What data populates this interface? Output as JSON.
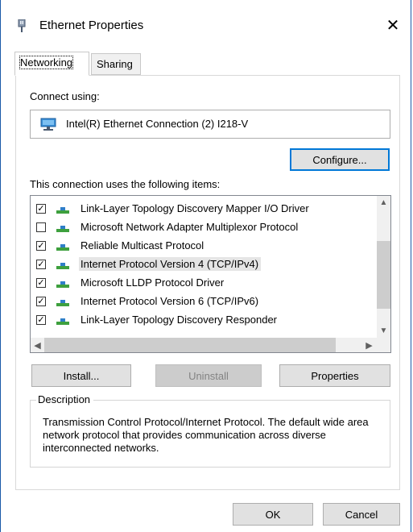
{
  "window": {
    "title": "Ethernet Properties",
    "close_glyph": "✕"
  },
  "tabs": [
    {
      "label": "Networking"
    },
    {
      "label": "Sharing"
    }
  ],
  "networking": {
    "connect_using_label": "Connect using:",
    "adapter_name": "Intel(R) Ethernet Connection (2) I218-V",
    "configure_label": "Configure...",
    "items_label": "This connection uses the following items:",
    "items": [
      {
        "label": "Link-Layer Topology Discovery Mapper I/O Driver",
        "checked": true,
        "icon": "network-protocol-icon"
      },
      {
        "label": "Microsoft Network Adapter Multiplexor Protocol",
        "checked": false,
        "icon": "network-protocol-icon"
      },
      {
        "label": "Reliable Multicast Protocol",
        "checked": true,
        "icon": "network-protocol-icon"
      },
      {
        "label": "Internet Protocol Version 4 (TCP/IPv4)",
        "checked": true,
        "icon": "network-protocol-icon",
        "selected": true
      },
      {
        "label": "Microsoft LLDP Protocol Driver",
        "checked": true,
        "icon": "network-protocol-icon"
      },
      {
        "label": "Internet Protocol Version 6 (TCP/IPv6)",
        "checked": true,
        "icon": "network-protocol-icon"
      },
      {
        "label": "Link-Layer Topology Discovery Responder",
        "checked": true,
        "icon": "network-protocol-icon"
      }
    ],
    "install_label": "Install...",
    "uninstall_label": "Uninstall",
    "properties_label": "Properties",
    "description_legend": "Description",
    "description_text": "Transmission Control Protocol/Internet Protocol. The default wide area network protocol that provides communication across diverse interconnected networks."
  },
  "footer": {
    "ok_label": "OK",
    "cancel_label": "Cancel"
  },
  "colors": {
    "accent": "#0078d7",
    "window_border": "#1a5aa8",
    "selection_bg": "#e5e5e5"
  }
}
